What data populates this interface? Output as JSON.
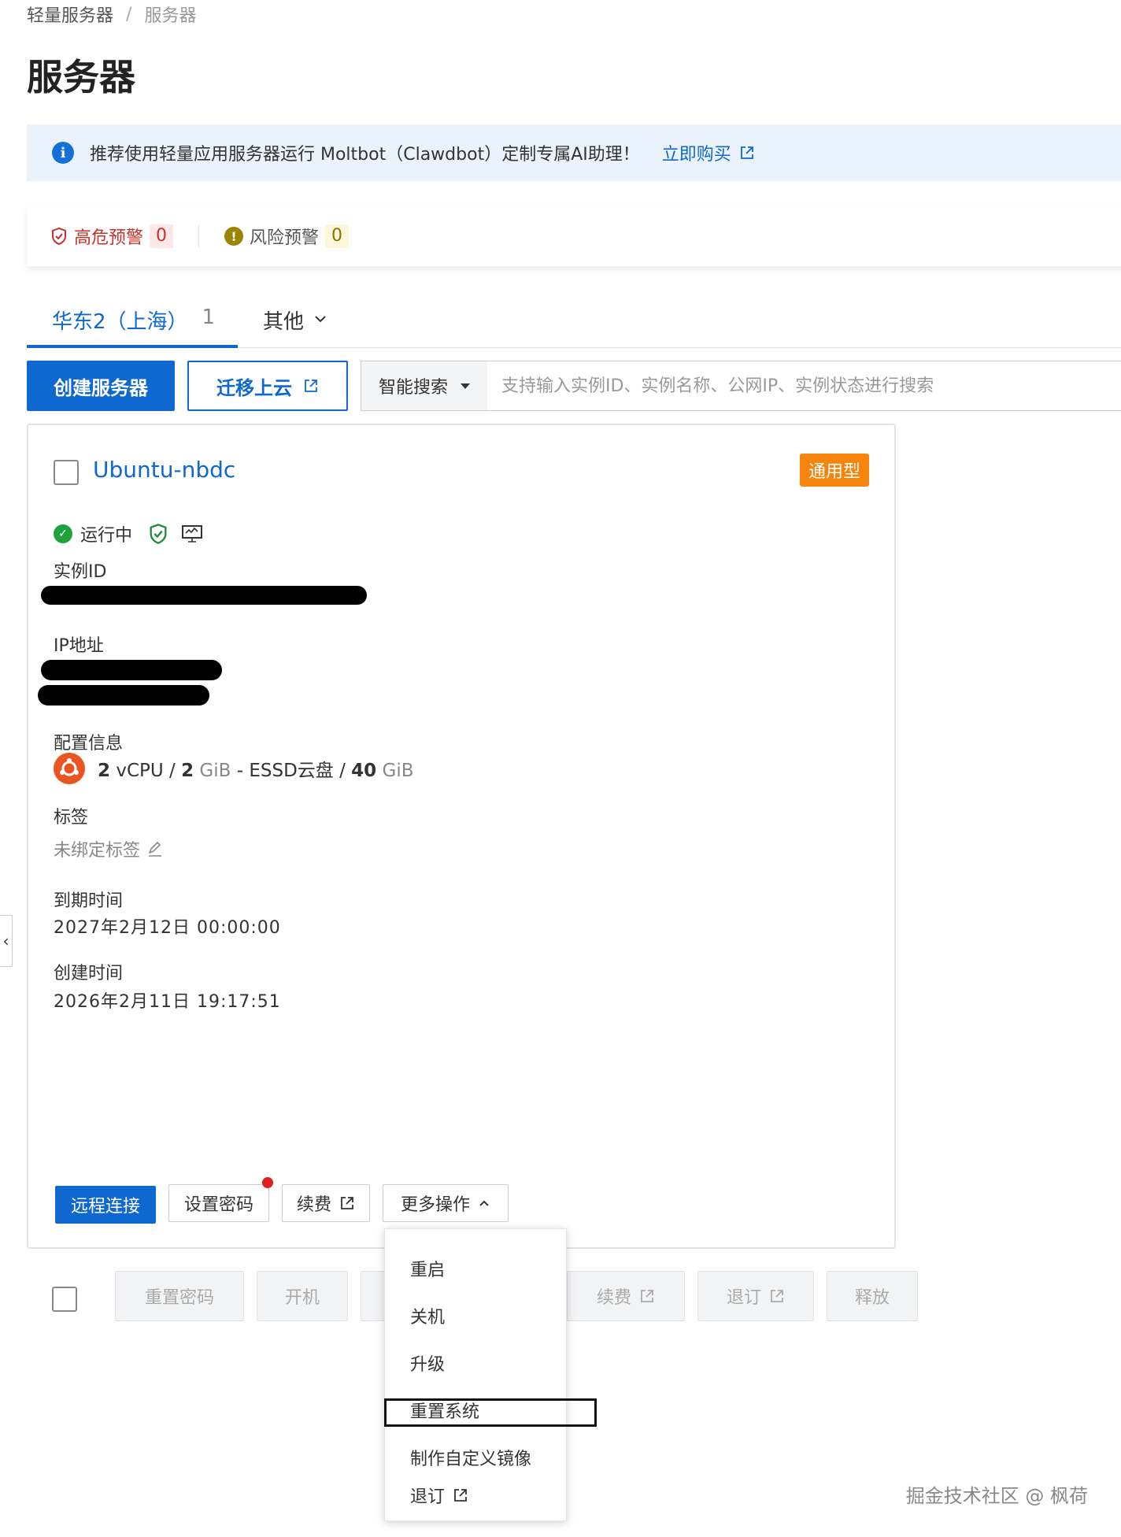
{
  "breadcrumb": {
    "parent": "轻量服务器",
    "separator": "/",
    "current": "服务器"
  },
  "page_title": "服务器",
  "banner": {
    "text": "推荐使用轻量应用服务器运行 Moltbot（Clawdbot）定制专属AI助理！",
    "link": "立即购买"
  },
  "alerts": {
    "high_label": "高危预警",
    "high_count": "0",
    "risk_label": "风险预警",
    "risk_count": "0"
  },
  "tabs": {
    "active_label": "华东2（上海）",
    "active_count": "1",
    "other_label": "其他"
  },
  "toolbar": {
    "create_label": "创建服务器",
    "migrate_label": "迁移上云",
    "search_type": "智能搜索",
    "search_placeholder": "支持输入实例ID、实例名称、公网IP、实例状态进行搜索"
  },
  "instance": {
    "name": "Ubuntu-nbdc",
    "type_badge": "通用型",
    "status": "运行中",
    "id_label": "实例ID",
    "ip_label": "IP地址",
    "config_label": "配置信息",
    "config": {
      "cpu_num": "2",
      "cpu_unit": "vCPU",
      "slash1": "/",
      "mem_num": "2",
      "mem_unit": "GiB",
      "dash": "-",
      "disk_type": "ESSD云盘",
      "slash2": "/",
      "disk_num": "40",
      "disk_unit": "GiB"
    },
    "tag_label": "标签",
    "tag_value": "未绑定标签",
    "expire_label": "到期时间",
    "expire_value": "2027年2月12日 00:00:00",
    "created_label": "创建时间",
    "created_value": "2026年2月11日 19:17:51",
    "actions": {
      "remote": "远程连接",
      "set_password": "设置密码",
      "renew": "续费",
      "more": "更多操作"
    }
  },
  "batch": {
    "reset_password": "重置密码",
    "start": "开机",
    "renew": "续费",
    "unsubscribe": "退订",
    "release": "释放"
  },
  "more_menu": {
    "items": [
      "重启",
      "关机",
      "升级",
      "重置系统",
      "制作自定义镜像"
    ],
    "unsubscribe": "退订"
  },
  "watermark": "掘金技术社区 @ 枫荷",
  "colors": {
    "primary": "#0e68cf",
    "danger": "#c8302a",
    "badge": "#f7840c",
    "running": "#1fa23b"
  }
}
